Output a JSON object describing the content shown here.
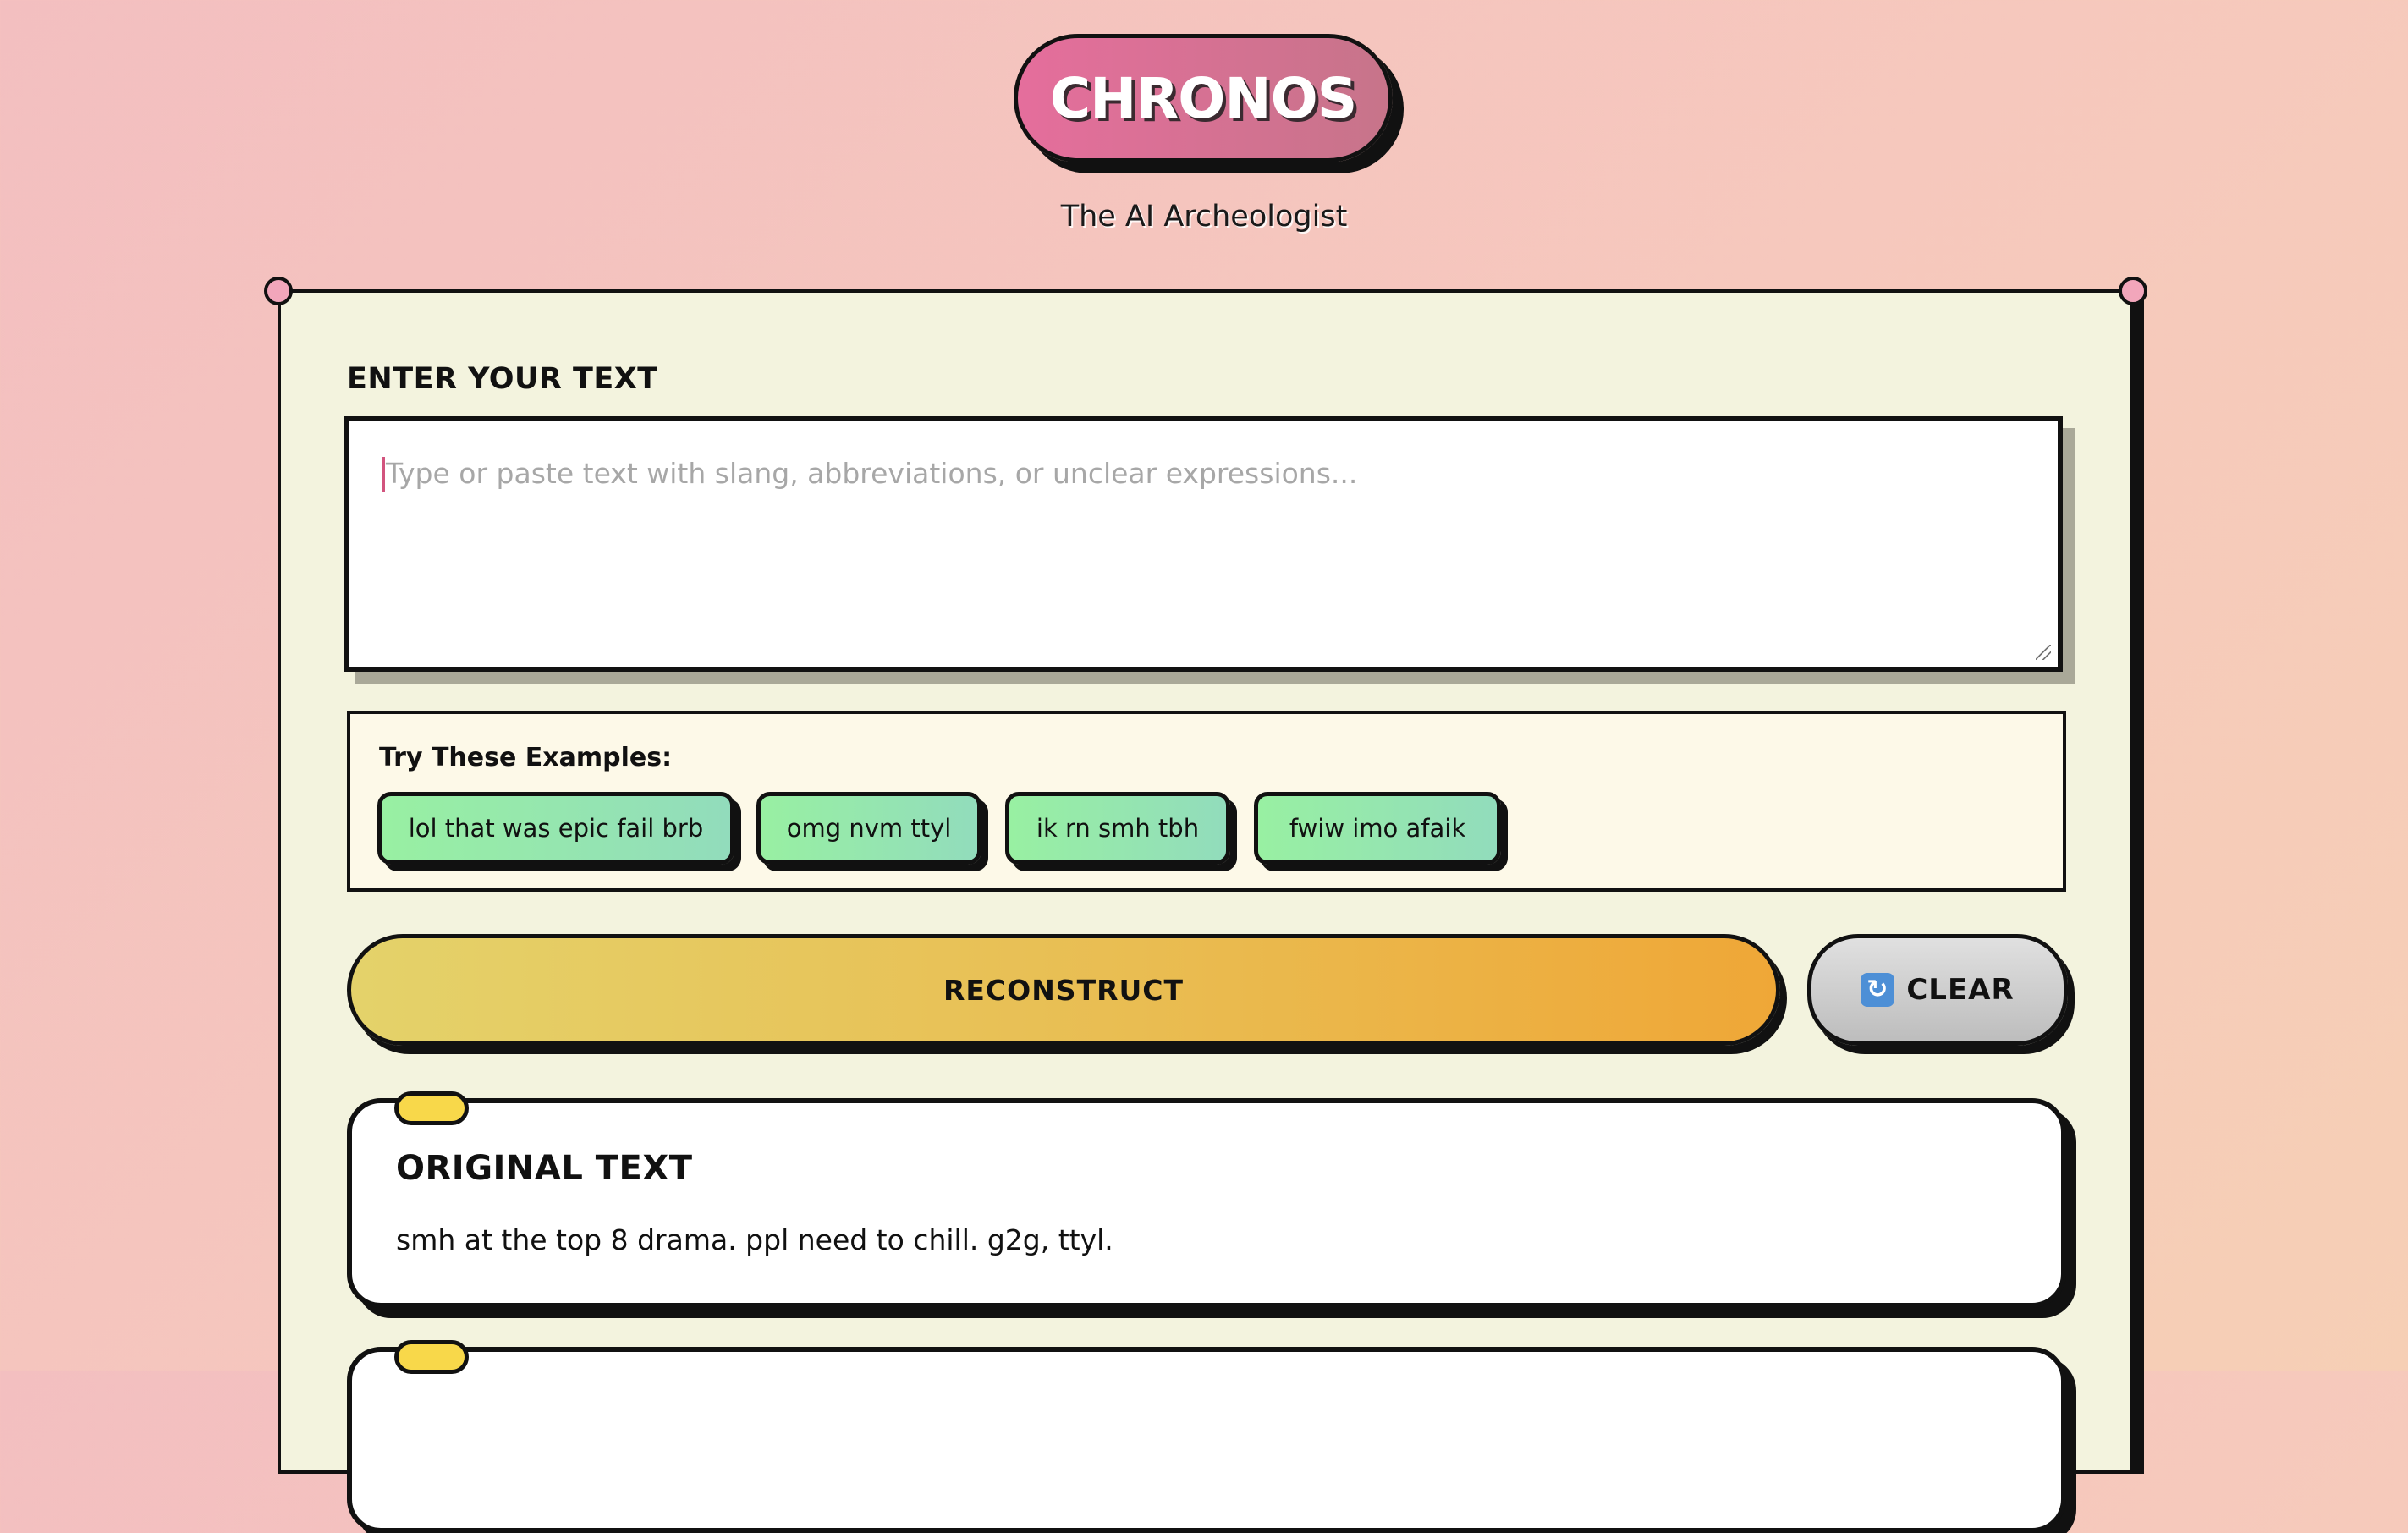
{
  "header": {
    "logo_text": "CHRONOS",
    "subtitle": "The AI Archeologist"
  },
  "input": {
    "label": "ENTER YOUR TEXT",
    "value": "",
    "placeholder": "Type or paste text with slang, abbreviations, or unclear expressions..."
  },
  "examples": {
    "title": "Try These Examples:",
    "items": [
      {
        "label": "lol that was epic fail brb"
      },
      {
        "label": "omg nvm ttyl"
      },
      {
        "label": "ik rn smh tbh"
      },
      {
        "label": "fwiw imo afaik"
      }
    ]
  },
  "actions": {
    "reconstruct_label": "RECONSTRUCT",
    "clear_label": "CLEAR",
    "clear_icon": "refresh-icon"
  },
  "results": {
    "original": {
      "title": "ORIGINAL TEXT",
      "text": "smh at the top 8 drama. ppl need to chill. g2g, ttyl."
    }
  },
  "colors": {
    "background_start": "#f3bfc0",
    "background_end": "#f6cfb5",
    "logo_pill": "#e56e9c",
    "panel": "#f3f3de",
    "example_chip": "#98f0a2",
    "reconstruct_button": "#efa737",
    "card_tab": "#f8d84a"
  }
}
